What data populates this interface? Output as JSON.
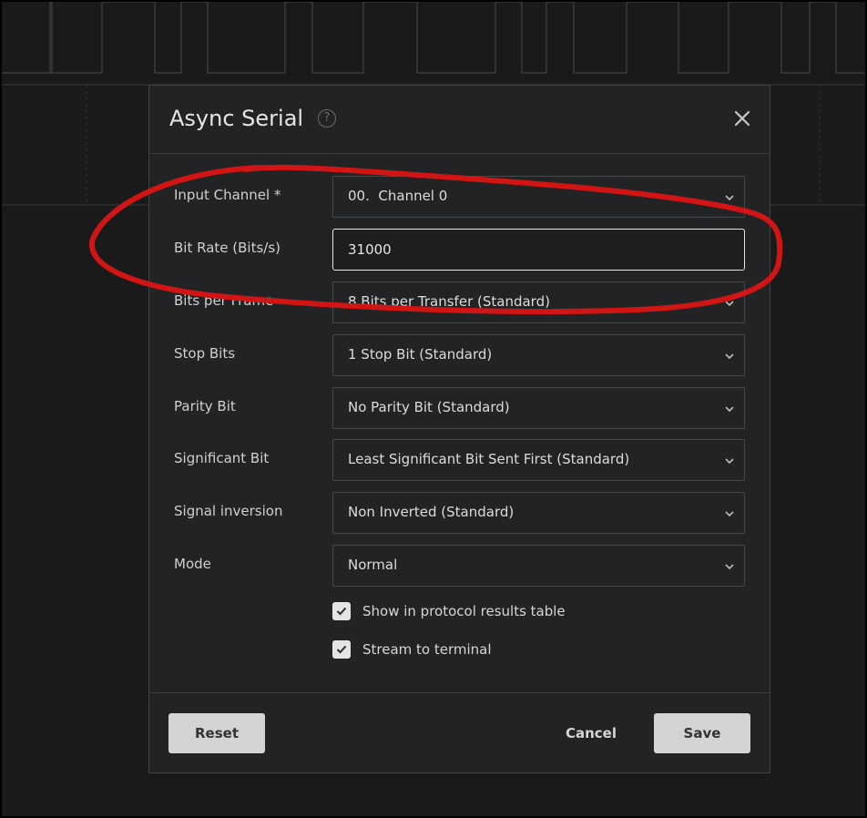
{
  "dialog": {
    "title": "Async Serial",
    "help_icon": "?",
    "close_icon": "close-icon"
  },
  "fields": [
    {
      "label": "Input Channel *",
      "value": "00.  Channel 0",
      "type": "select"
    },
    {
      "label": "Bit Rate (Bits/s)",
      "value": "31000",
      "type": "input"
    },
    {
      "label": "Bits per Frame",
      "value": "8 Bits per Transfer (Standard)",
      "type": "select"
    },
    {
      "label": "Stop Bits",
      "value": "1 Stop Bit (Standard)",
      "type": "select"
    },
    {
      "label": "Parity Bit",
      "value": "No Parity Bit (Standard)",
      "type": "select"
    },
    {
      "label": "Significant Bit",
      "value": "Least Significant Bit Sent First (Standard)",
      "type": "select"
    },
    {
      "label": "Signal inversion",
      "value": "Non Inverted (Standard)",
      "type": "select"
    },
    {
      "label": "Mode",
      "value": "Normal",
      "type": "select"
    }
  ],
  "checkboxes": [
    {
      "label": "Show in protocol results table",
      "checked": true
    },
    {
      "label": "Stream to terminal",
      "checked": true
    }
  ],
  "footer": {
    "reset_label": "Reset",
    "cancel_label": "Cancel",
    "save_label": "Save"
  },
  "colors": {
    "background": "#1a1a1a",
    "dialog": "#222324",
    "annotation": "#d11414"
  }
}
